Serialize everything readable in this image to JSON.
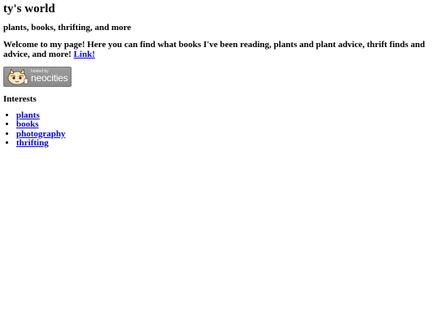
{
  "page": {
    "title": "ty's world",
    "subtitle": "plants, books, thrifting, and more",
    "welcome_text": "Welcome to my page! Here you can find what books I've been reading, plants and plant advice, thrift finds and advice, and more!",
    "welcome_link": "Link!"
  },
  "badge": {
    "hosted_by": "hosted by",
    "brand": "neocities",
    "icon": "neocities-cat-icon"
  },
  "interests": {
    "heading": "Interests",
    "items": [
      "plants",
      "books",
      "photography",
      "thrifting"
    ]
  }
}
